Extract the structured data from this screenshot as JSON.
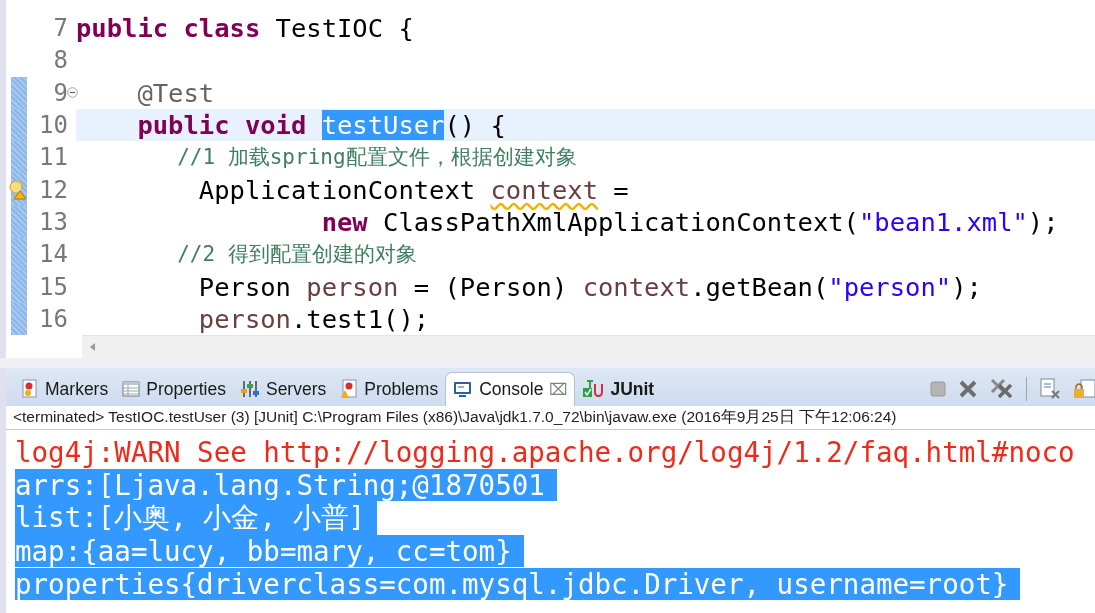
{
  "editor": {
    "lines": [
      {
        "number": "7",
        "changed": false,
        "current": false,
        "fold": false,
        "warning": false,
        "tokens": [
          {
            "kind": "keyword",
            "text": "public "
          },
          {
            "kind": "keyword",
            "text": "class "
          },
          {
            "kind": "plain",
            "text": "TestIOC {"
          }
        ]
      },
      {
        "number": "8",
        "changed": false,
        "current": false,
        "fold": false,
        "warning": false
      },
      {
        "number": "9",
        "changed": true,
        "current": false,
        "fold": true,
        "warning": false,
        "tokens": [
          {
            "kind": "annotation",
            "text": "    @Test"
          }
        ]
      },
      {
        "number": "10",
        "changed": true,
        "current": true,
        "fold": false,
        "warning": false,
        "tokens": [
          {
            "kind": "keyword",
            "text": "    public "
          },
          {
            "kind": "keyword",
            "text": "void "
          },
          {
            "kind": "selection",
            "text": "testUser"
          },
          {
            "kind": "plain",
            "text": "() {"
          }
        ]
      },
      {
        "number": "11",
        "changed": true,
        "current": false,
        "fold": false,
        "warning": false,
        "tokens": [
          {
            "kind": "comment",
            "text": "        //1 加载spring配置文件，根据创建对象"
          }
        ]
      },
      {
        "number": "12",
        "changed": true,
        "current": false,
        "fold": false,
        "warning": true,
        "tokens": [
          {
            "kind": "plain",
            "text": "        ApplicationContext "
          },
          {
            "kind": "warned-variable",
            "text": "context"
          },
          {
            "kind": "plain",
            "text": " ="
          }
        ]
      },
      {
        "number": "13",
        "changed": true,
        "current": false,
        "fold": false,
        "warning": false,
        "tokens": [
          {
            "kind": "keyword",
            "text": "                new "
          },
          {
            "kind": "plain",
            "text": "ClassPathXmlApplicationContext("
          },
          {
            "kind": "string",
            "text": "\"bean1.xml\""
          },
          {
            "kind": "plain",
            "text": ");"
          }
        ]
      },
      {
        "number": "14",
        "changed": true,
        "current": false,
        "fold": false,
        "warning": false,
        "tokens": [
          {
            "kind": "comment",
            "text": "        //2 得到配置创建的对象"
          }
        ]
      },
      {
        "number": "15",
        "changed": true,
        "current": false,
        "fold": false,
        "warning": false,
        "tokens": [
          {
            "kind": "plain",
            "text": "        Person "
          },
          {
            "kind": "variable",
            "text": "person"
          },
          {
            "kind": "plain",
            "text": " = (Person) "
          },
          {
            "kind": "variable",
            "text": "context"
          },
          {
            "kind": "plain",
            "text": ".getBean("
          },
          {
            "kind": "string",
            "text": "\"person\""
          },
          {
            "kind": "plain",
            "text": ");"
          }
        ]
      },
      {
        "number": "16",
        "changed": true,
        "current": false,
        "fold": false,
        "warning": false,
        "tokens": [
          {
            "kind": "variable",
            "text": "        person"
          },
          {
            "kind": "plain",
            "text": ".test1();"
          }
        ]
      }
    ]
  },
  "panel": {
    "tabs": [
      {
        "label": "Markers",
        "selected": false,
        "updated": false
      },
      {
        "label": "Properties",
        "selected": false,
        "updated": false
      },
      {
        "label": "Servers",
        "selected": false,
        "updated": false
      },
      {
        "label": "Problems",
        "selected": false,
        "updated": false
      },
      {
        "label": "Console",
        "selected": true,
        "updated": false,
        "close": "⌧"
      },
      {
        "label": "JUnit",
        "selected": false,
        "updated": true
      }
    ],
    "status": "<terminated> TestIOC.testUser (3) [JUnit] C:\\Program Files (x86)\\Java\\jdk1.7.0_72\\bin\\javaw.exe (2016年9月25日 下午12:06:24)",
    "console": [
      {
        "kind": "error",
        "selected": false,
        "text": "log4j:WARN See http://logging.apache.org/log4j/1.2/faq.html#noco"
      },
      {
        "kind": "output",
        "selected": true,
        "text": "arrs:[Ljava.lang.String;@1870501"
      },
      {
        "kind": "output",
        "selected": true,
        "text": "list:[小奥, 小金, 小普]"
      },
      {
        "kind": "output",
        "selected": true,
        "text": "map:{aa=lucy, bb=mary, cc=tom}"
      },
      {
        "kind": "output",
        "selected": true,
        "text": "properties{driverclass=com.mysql.jdbc.Driver, username=root}"
      }
    ]
  }
}
